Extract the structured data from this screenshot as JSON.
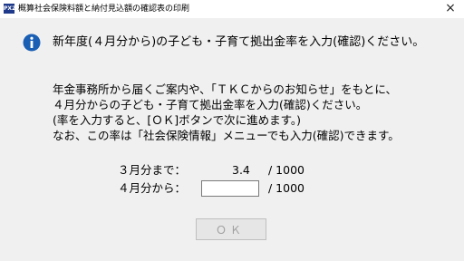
{
  "window": {
    "title": "概算社会保険料額と納付見込額の確認表の印刷",
    "app_icon_text": "PX2",
    "close_glyph": "×"
  },
  "dialog": {
    "headline": "新年度(４月分から)の子ども・子育て拠出金率を入力(確認)ください。",
    "body_lines": [
      "年金事務所から届くご案内や、「ＴＫＣからのお知らせ」をもとに、",
      "４月分からの子ども・子育て拠出金率を入力(確認)ください。",
      "(率を入力すると、[ＯＫ]ボタンで次に進めます。)",
      "なお、この率は「社会保険情報」メニューでも入力(確認)できます。"
    ],
    "rate_until_march": {
      "label": "３月分まで：",
      "value": "3.4",
      "unit": "/ 1000"
    },
    "rate_from_april": {
      "label": "４月分から：",
      "value": "",
      "unit": "/ 1000"
    },
    "ok_label": "ＯＫ"
  },
  "colors": {
    "dialog_bg": "#f0f0f0",
    "info_icon": "#1a5fb4",
    "disabled_text": "#a0a0a0"
  }
}
